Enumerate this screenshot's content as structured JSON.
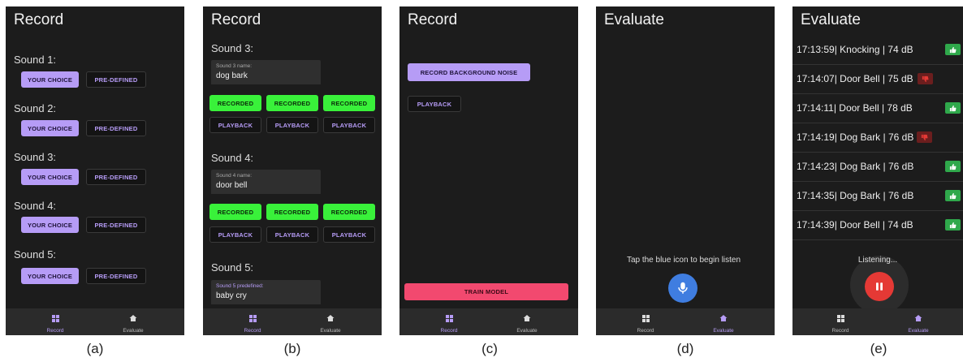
{
  "colors": {
    "panel_bg": "#1c1c1c",
    "accent_purple": "#b69cf6",
    "recorded_green": "#39f13a",
    "train_pink": "#f2496f",
    "mic_blue": "#3f7de0",
    "pause_red": "#e53935",
    "thumb_up_green": "#2fa84b",
    "thumb_down_red": "#6b1e1e"
  },
  "nav": {
    "record": "Record",
    "evaluate": "Evaluate"
  },
  "panel_a": {
    "title": "Record",
    "caption": "(a)",
    "sounds": [
      {
        "label": "Sound 1:",
        "choice": "YOUR CHOICE",
        "predefined": "PRE-DEFINED"
      },
      {
        "label": "Sound 2:",
        "choice": "YOUR CHOICE",
        "predefined": "PRE-DEFINED"
      },
      {
        "label": "Sound 3:",
        "choice": "YOUR CHOICE",
        "predefined": "PRE-DEFINED"
      },
      {
        "label": "Sound 4:",
        "choice": "YOUR CHOICE",
        "predefined": "PRE-DEFINED"
      },
      {
        "label": "Sound 5:",
        "choice": "YOUR CHOICE",
        "predefined": "PRE-DEFINED"
      }
    ]
  },
  "panel_b": {
    "title": "Record",
    "caption": "(b)",
    "sound3": {
      "label": "Sound 3:",
      "field_label": "Sound 3 name:",
      "field_value": "dog bark",
      "recorded": [
        "RECORDED",
        "RECORDED",
        "RECORDED"
      ],
      "playback": [
        "PLAYBACK",
        "PLAYBACK",
        "PLAYBACK"
      ]
    },
    "sound4": {
      "label": "Sound 4:",
      "field_label": "Sound 4 name:",
      "field_value": "door bell",
      "recorded": [
        "RECORDED",
        "RECORDED",
        "RECORDED"
      ],
      "playback": [
        "PLAYBACK",
        "PLAYBACK",
        "PLAYBACK"
      ]
    },
    "sound5": {
      "label": "Sound 5:",
      "field_label": "Sound 5 predefined:",
      "field_value": "baby cry"
    }
  },
  "panel_c": {
    "title": "Record",
    "caption": "(c)",
    "record_noise": "RECORD BACKGROUND NOISE",
    "playback": "PLAYBACK",
    "train": "TRAIN MODEL"
  },
  "panel_d": {
    "title": "Evaluate",
    "caption": "(d)",
    "hint": "Tap the blue icon to begin listen"
  },
  "panel_e": {
    "title": "Evaluate",
    "caption": "(e)",
    "status": "Listening...",
    "results": [
      {
        "text": "17:13:59| Knocking | 74 dB",
        "feedback": "up"
      },
      {
        "text": "17:14:07| Door Bell | 75 dB",
        "feedback": "down"
      },
      {
        "text": "17:14:11| Door Bell | 78 dB",
        "feedback": "up"
      },
      {
        "text": "17:14:19| Dog Bark | 76 dB",
        "feedback": "down"
      },
      {
        "text": "17:14:23| Dog Bark | 76 dB",
        "feedback": "up"
      },
      {
        "text": "17:14:35| Dog Bark | 76 dB",
        "feedback": "up"
      },
      {
        "text": "17:14:39| Door Bell | 74 dB",
        "feedback": "up"
      }
    ]
  }
}
